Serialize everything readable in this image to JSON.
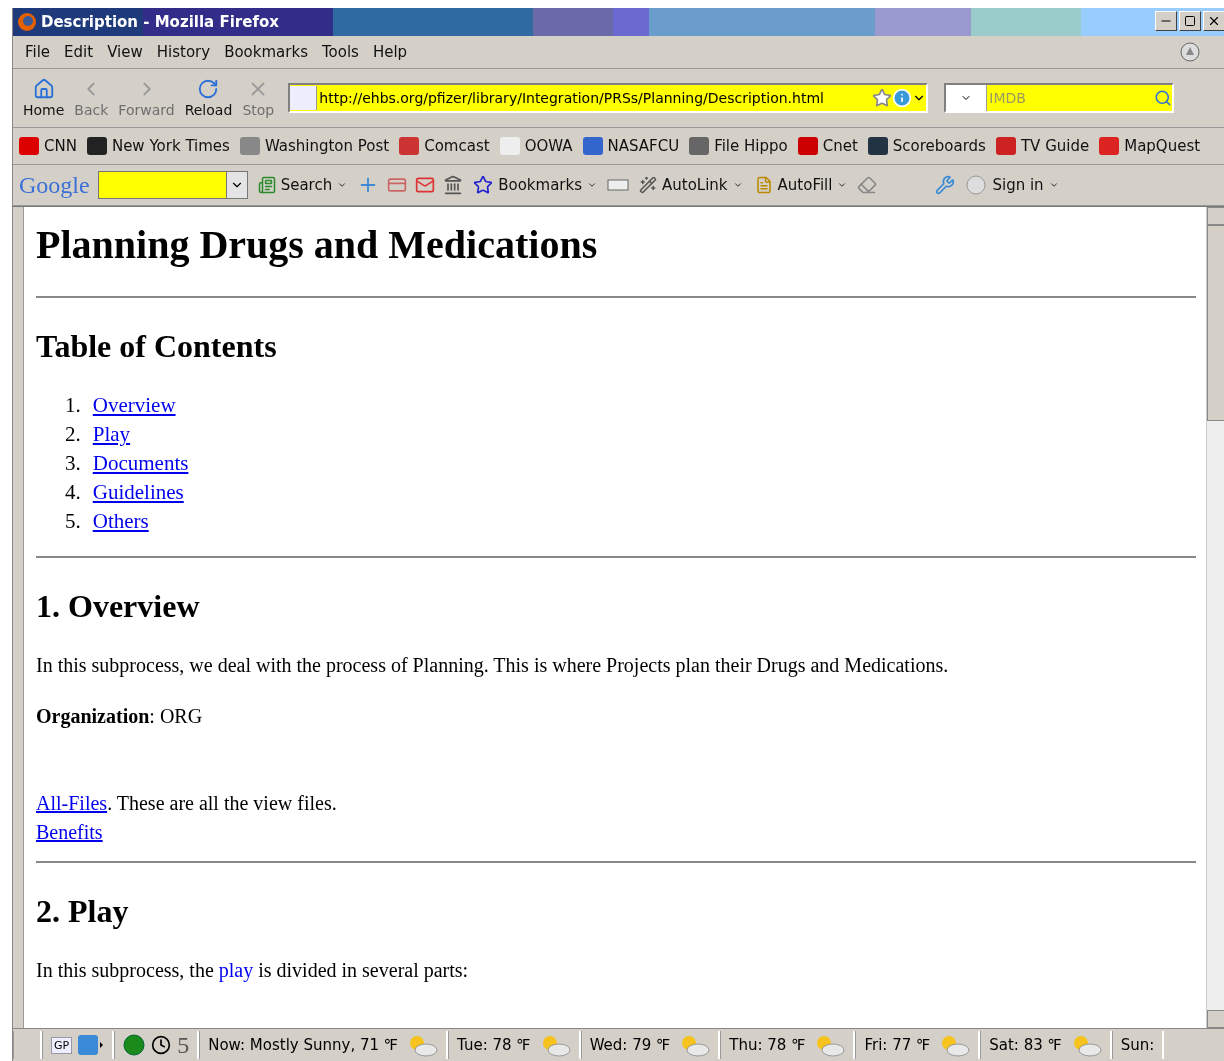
{
  "window": {
    "title": "Description - Mozilla Firefox"
  },
  "menu": [
    "File",
    "Edit",
    "View",
    "History",
    "Bookmarks",
    "Tools",
    "Help"
  ],
  "nav_buttons": [
    {
      "kind": "home",
      "label": "Home",
      "disabled": false
    },
    {
      "kind": "back",
      "label": "Back",
      "disabled": true
    },
    {
      "kind": "forward",
      "label": "Forward",
      "disabled": true
    },
    {
      "kind": "reload",
      "label": "Reload",
      "disabled": false
    },
    {
      "kind": "stop",
      "label": "Stop",
      "disabled": true
    }
  ],
  "address": {
    "value": "http://ehbs.org/pfizer/library/Integration/PRSs/Planning/Description.html"
  },
  "search": {
    "placeholder": "IMDB"
  },
  "bookmarks": [
    "CNN",
    "New York Times",
    "Washington Post",
    "Comcast",
    "OOWA",
    "NASAFCU",
    "File Hippo",
    "Cnet",
    "Scoreboards",
    "TV Guide",
    "MapQuest"
  ],
  "google_toolbar": {
    "logo": "Google",
    "search_label": "Search",
    "bookmarks_label": "Bookmarks",
    "autolink_label": "AutoLink",
    "autofill_label": "AutoFill",
    "sign_in_label": "Sign in"
  },
  "content": {
    "title": "Planning Drugs and Medications",
    "toc_heading": "Table of Contents",
    "toc": [
      {
        "number": "1.",
        "label": "Overview"
      },
      {
        "number": "2.",
        "label": "Play"
      },
      {
        "number": "3.",
        "label": "Documents"
      },
      {
        "number": "4.",
        "label": "Guidelines"
      },
      {
        "number": "5.",
        "label": "Others"
      }
    ],
    "sections": [
      {
        "heading": "1. Overview",
        "blocks": [
          {
            "kind": "para",
            "before": "In this subprocess, we deal with the process of Planning. This is where Projects plan their Drugs and Medications."
          },
          {
            "kind": "para",
            "before": "**Organization**: ORG"
          },
          {
            "kind": "line",
            "link": "All-Files",
            "after": ". These are all the view files."
          },
          {
            "kind": "line",
            "link": "Benefits"
          }
        ]
      },
      {
        "heading": "2. Play",
        "blocks": [
          {
            "kind": "para",
            "before": "In this subprocess, the ",
            "link": "play",
            "after": " is divided in several parts:"
          }
        ]
      }
    ]
  },
  "status_bar": {
    "gp_label": "GP",
    "count": "5",
    "weather": [
      "Now: Mostly Sunny, 71 ℉",
      "Tue: 78 ℉",
      "Wed: 79 ℉",
      "Thu: 78 ℉",
      "Fri: 77 ℉",
      "Sat: 83 ℉",
      "Sun:"
    ]
  }
}
